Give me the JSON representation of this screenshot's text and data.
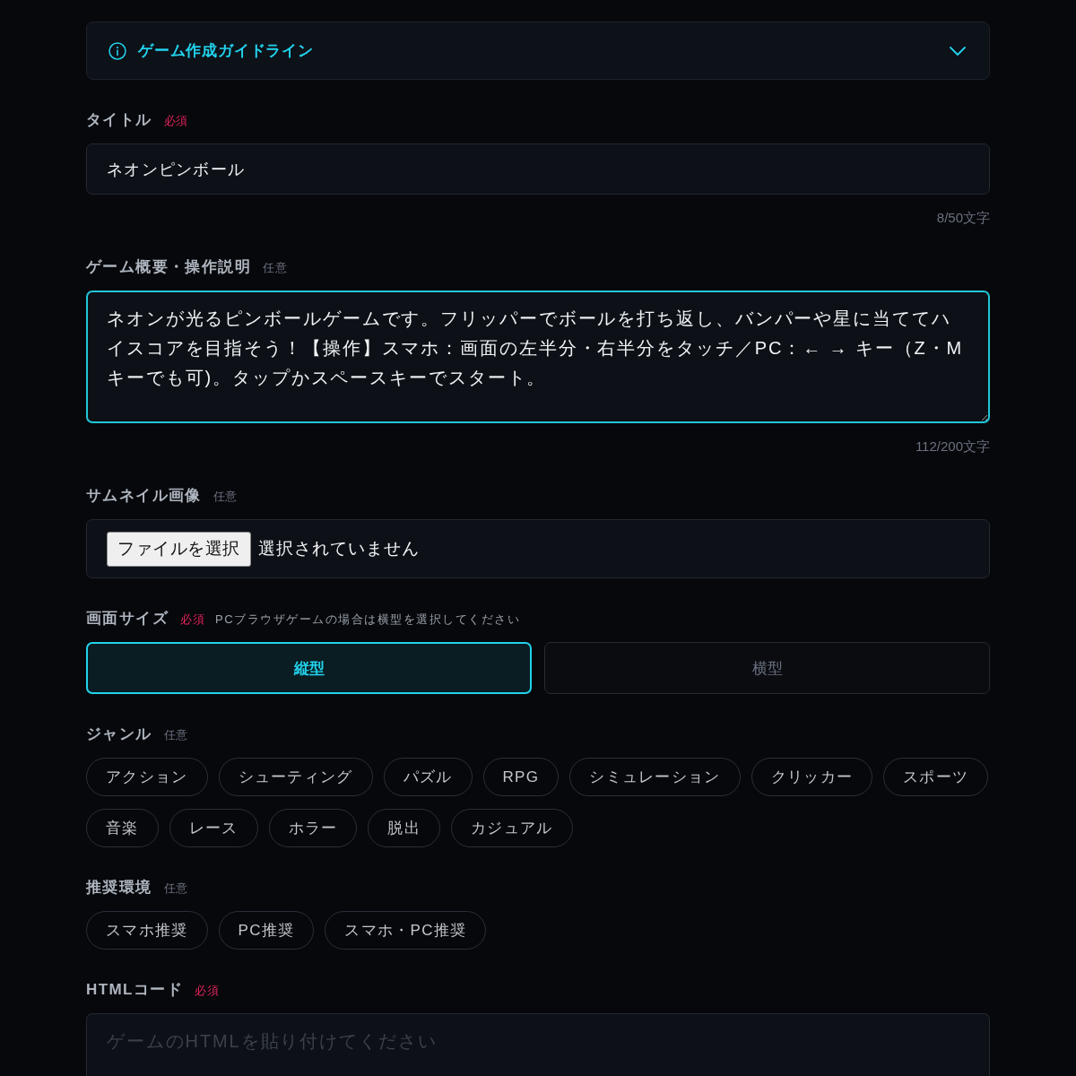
{
  "guide": {
    "title": "ゲーム作成ガイドライン",
    "expanded": false
  },
  "fields": [
    {
      "kind": "text",
      "label": "タイトル",
      "badge": "必須",
      "required": true,
      "value": "ネオンピンボール",
      "counter": "8/50文字"
    },
    {
      "kind": "textarea",
      "label": "ゲーム概要・操作説明",
      "badge": "任意",
      "required": false,
      "value": "ネオンが光るピンボールゲームです。フリッパーでボールを打ち返し、バンパーや星に当ててハイスコアを目指そう！【操作】スマホ：画面の左半分・右半分をタッチ／PC：← → キー（Z・Mキーでも可)。タップかスペースキーでスタート。",
      "focused": true,
      "counter": "112/200文字"
    },
    {
      "kind": "file",
      "label": "サムネイル画像",
      "badge": "任意",
      "required": false,
      "button": "ファイルを選択",
      "status": "選択されていません"
    },
    {
      "kind": "segmented",
      "label": "画面サイズ",
      "badge": "必須",
      "required": true,
      "hint": "PCブラウザゲームの場合は横型を選択してください",
      "options": [
        {
          "label": "縦型",
          "selected": true
        },
        {
          "label": "横型",
          "selected": false
        }
      ]
    },
    {
      "kind": "chips",
      "label": "ジャンル",
      "badge": "任意",
      "required": false,
      "options": [
        {
          "label": "アクション",
          "selected": false
        },
        {
          "label": "シューティング",
          "selected": false
        },
        {
          "label": "パズル",
          "selected": false
        },
        {
          "label": "RPG",
          "selected": false
        },
        {
          "label": "シミュレーション",
          "selected": false
        },
        {
          "label": "クリッカー",
          "selected": false
        },
        {
          "label": "スポーツ",
          "selected": false
        },
        {
          "label": "音楽",
          "selected": false
        },
        {
          "label": "レース",
          "selected": false
        },
        {
          "label": "ホラー",
          "selected": false
        },
        {
          "label": "脱出",
          "selected": false
        },
        {
          "label": "カジュアル",
          "selected": false
        }
      ]
    },
    {
      "kind": "chips",
      "label": "推奨環境",
      "badge": "任意",
      "required": false,
      "options": [
        {
          "label": "スマホ推奨",
          "selected": false
        },
        {
          "label": "PC推奨",
          "selected": false
        },
        {
          "label": "スマホ・PC推奨",
          "selected": false
        }
      ]
    },
    {
      "kind": "textarea",
      "label": "HTMLコード",
      "badge": "必須",
      "required": true,
      "placeholder": "ゲームのHTMLを貼り付けてください",
      "focused": false
    }
  ]
}
